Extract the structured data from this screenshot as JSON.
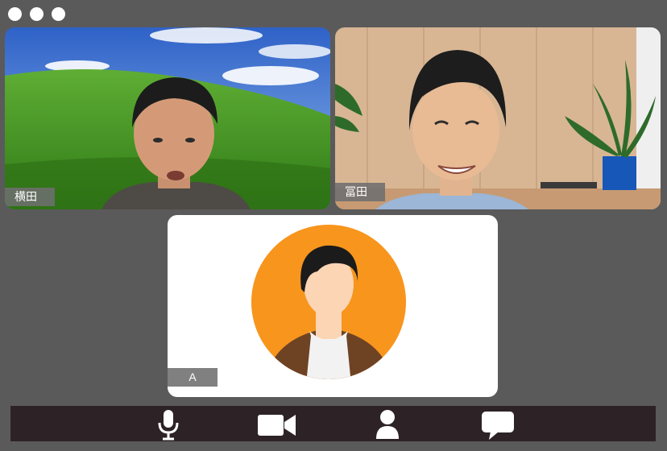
{
  "window": {
    "controls": [
      "window-dot",
      "window-dot",
      "window-dot"
    ]
  },
  "participants": [
    {
      "name": "横田",
      "background": "green-hill-sky"
    },
    {
      "name": "冨田",
      "background": "wood-wall-room"
    },
    {
      "name": "A",
      "avatar": "default-avatar"
    }
  ],
  "toolbar": {
    "buttons": [
      {
        "icon": "microphone-icon"
      },
      {
        "icon": "video-camera-icon"
      },
      {
        "icon": "participants-icon"
      },
      {
        "icon": "chat-icon"
      }
    ]
  },
  "colors": {
    "frame": "#5a5a5a",
    "toolbar": "#2d2326",
    "avatar_circle": "#f7951d",
    "icon": "#ffffff"
  }
}
